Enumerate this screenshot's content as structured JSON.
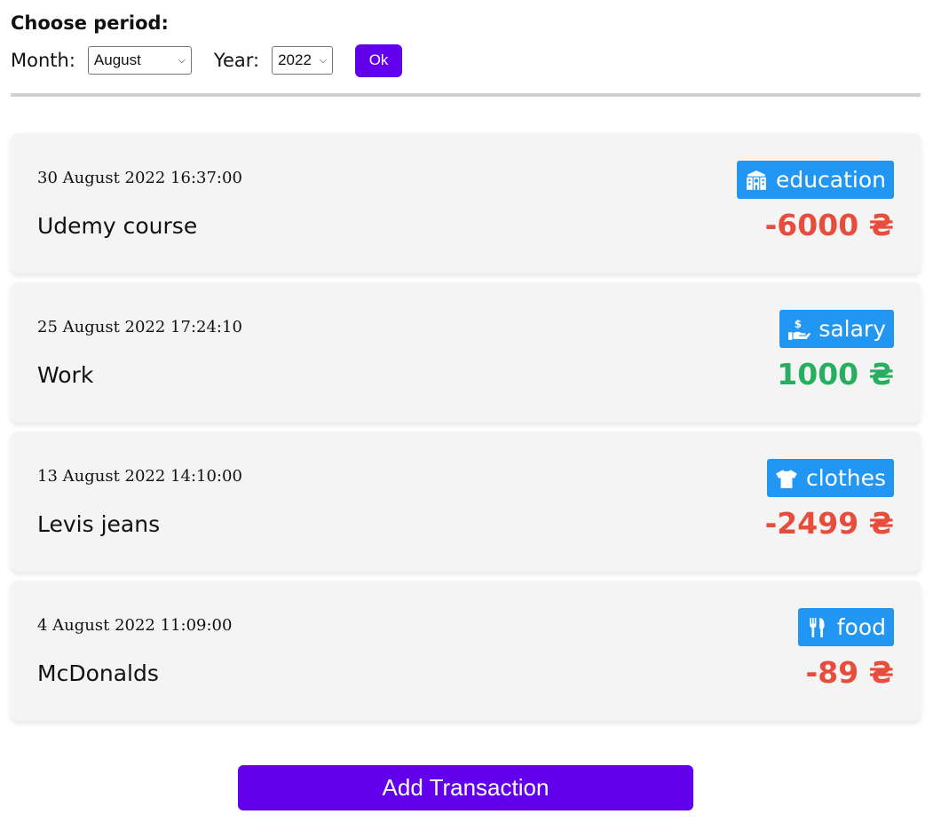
{
  "period": {
    "title": "Choose period:",
    "month_label": "Month:",
    "month_value": "August",
    "year_label": "Year:",
    "year_value": "2022",
    "ok_label": "Ok"
  },
  "transactions": [
    {
      "date": "30 August 2022 16:37:00",
      "title": "Udemy course",
      "category": "education",
      "category_icon": "school-icon",
      "amount": "-6000 ₴",
      "amount_color": "#e74c3c"
    },
    {
      "date": "25 August 2022 17:24:10",
      "title": "Work",
      "category": "salary",
      "category_icon": "hand-dollar-icon",
      "amount": "1000 ₴",
      "amount_color": "#27ae60"
    },
    {
      "date": "13 August 2022 14:10:00",
      "title": "Levis jeans",
      "category": "clothes",
      "category_icon": "tshirt-icon",
      "amount": "-2499 ₴",
      "amount_color": "#e74c3c"
    },
    {
      "date": "4 August 2022 11:09:00",
      "title": "McDonalds",
      "category": "food",
      "category_icon": "utensils-icon",
      "amount": "-89 ₴",
      "amount_color": "#e74c3c"
    }
  ],
  "colors": {
    "accent": "#6200ee",
    "badge": "#2196f3",
    "negative": "#e74c3c",
    "positive": "#27ae60"
  },
  "add_button_label": "Add Transaction"
}
